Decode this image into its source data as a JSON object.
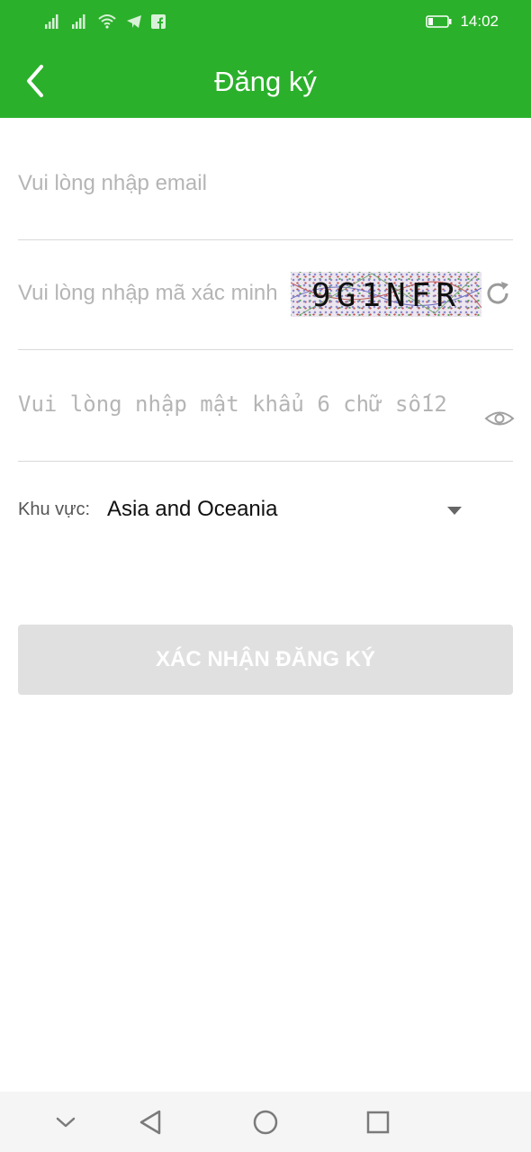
{
  "status_bar": {
    "time": "14:02",
    "icons": [
      "signal-icon",
      "signal-icon",
      "wifi-icon",
      "telegram-icon",
      "facebook-icon",
      "battery-icon"
    ]
  },
  "app_bar": {
    "title": "Đăng ký",
    "back_icon": "chevron-left-icon"
  },
  "form": {
    "email_placeholder": "Vui lòng nhập email",
    "email_value": "",
    "captcha_placeholder": "Vui lòng nhập mã xác minh",
    "captcha_value": "",
    "captcha_text": "9G1NFR",
    "refresh_icon": "refresh-icon",
    "password_placeholder": "Vui lòng nhập mật khẩu 6 chữ số12",
    "password_value": "",
    "eye_icon": "eye-icon",
    "region_label": "Khu vực:",
    "region_value": "Asia and Oceania",
    "submit_label": "XÁC NHẬN ĐĂNG KÝ"
  },
  "colors": {
    "primary": "#2bb02b",
    "button_disabled": "#e0e0e0"
  },
  "nav_bar": {
    "buttons": [
      "chevron-down-icon",
      "back-triangle-icon",
      "home-circle-icon",
      "recents-square-icon"
    ]
  }
}
